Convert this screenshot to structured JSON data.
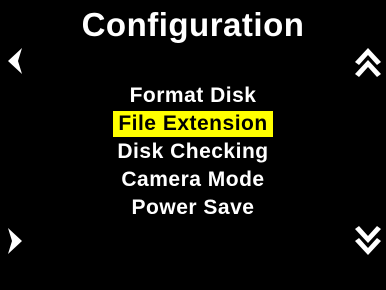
{
  "screen": {
    "title": "Configuration",
    "menu_items": [
      {
        "label": "Format Disk",
        "selected": false
      },
      {
        "label": "File Extension",
        "selected": true
      },
      {
        "label": "Disk Checking",
        "selected": false
      },
      {
        "label": "Camera Mode",
        "selected": false
      },
      {
        "label": "Power Save",
        "selected": false
      }
    ],
    "nav_icons": {
      "left": "left-arrow-icon",
      "right": "right-arrow-icon",
      "up": "double-chevron-up-icon",
      "down": "double-chevron-down-icon"
    },
    "colors": {
      "background": "#000000",
      "text": "#ffffff",
      "highlight": "#ffff00",
      "highlight_text": "#000000"
    }
  }
}
